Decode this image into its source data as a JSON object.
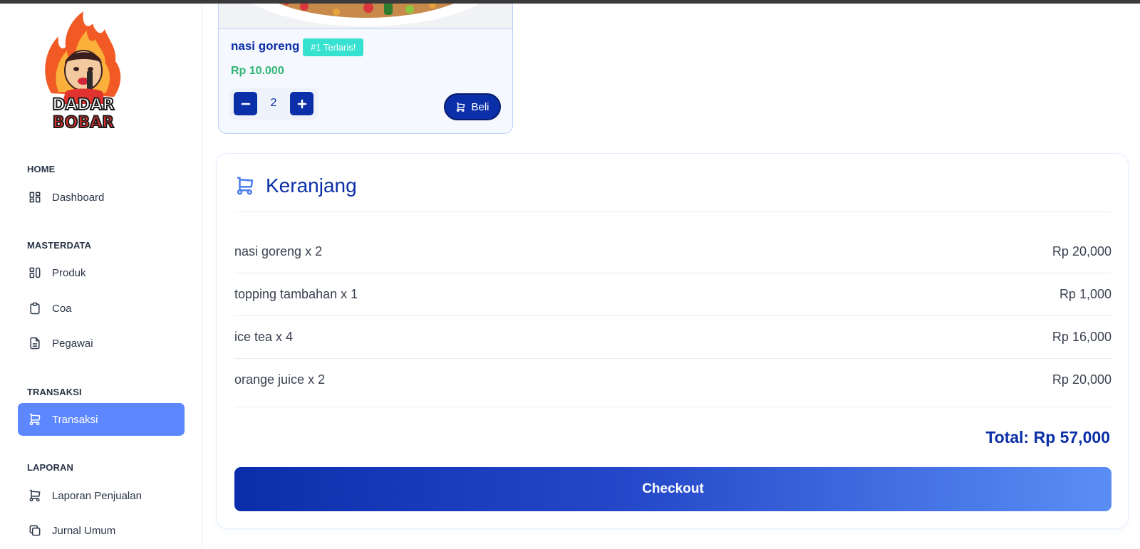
{
  "brand": {
    "logo_line1": "DADAR",
    "logo_line2": "BOBAR"
  },
  "sidebar": {
    "sections": [
      {
        "title": "HOME",
        "items": [
          {
            "label": "Dashboard",
            "icon": "dashboard-icon"
          }
        ]
      },
      {
        "title": "MASTERDATA",
        "items": [
          {
            "label": "Produk",
            "icon": "product-icon"
          },
          {
            "label": "Coa",
            "icon": "clipboard-icon"
          },
          {
            "label": "Pegawai",
            "icon": "document-icon"
          }
        ]
      },
      {
        "title": "TRANSAKSI",
        "items": [
          {
            "label": "Transaksi",
            "icon": "cart-icon",
            "active": true
          }
        ]
      },
      {
        "title": "LAPORAN",
        "items": [
          {
            "label": "Laporan Penjualan",
            "icon": "cart-icon"
          },
          {
            "label": "Jurnal Umum",
            "icon": "copy-icon"
          }
        ]
      }
    ]
  },
  "product": {
    "name": "nasi goreng",
    "badge": "#1 Terlaris!",
    "price": "Rp 10.000",
    "quantity": "2",
    "buy_label": "Beli"
  },
  "cart": {
    "title": "Keranjang",
    "items": [
      {
        "label": "nasi goreng x 2",
        "price": "Rp 20,000"
      },
      {
        "label": "topping tambahan x 1",
        "price": "Rp 1,000"
      },
      {
        "label": "ice tea x 4",
        "price": "Rp 16,000"
      },
      {
        "label": "orange juice x 2",
        "price": "Rp 20,000"
      }
    ],
    "total": "Total: Rp 57,000",
    "checkout_label": "Checkout"
  },
  "colors": {
    "accent": "#5d87ff",
    "primary": "#0b2fa8",
    "price_green": "#2fb573",
    "badge": "#36e2cf"
  }
}
